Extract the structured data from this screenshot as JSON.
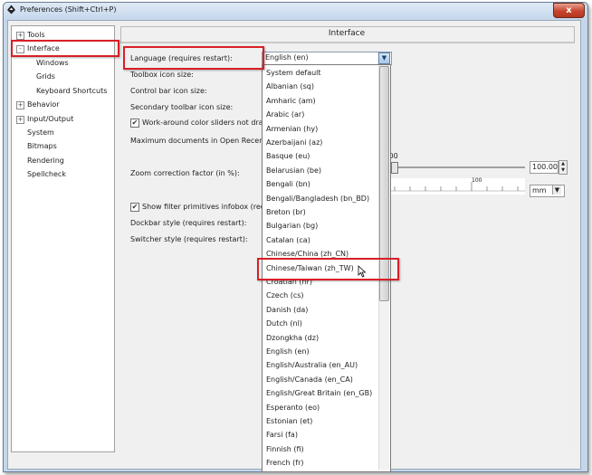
{
  "window": {
    "title": "Preferences (Shift+Ctrl+P)",
    "close_label": "x"
  },
  "sidebar": {
    "items": [
      {
        "label": "Tools",
        "expander": "+"
      },
      {
        "label": "Interface",
        "expander": "-"
      },
      {
        "label": "Windows"
      },
      {
        "label": "Grids"
      },
      {
        "label": "Keyboard Shortcuts"
      },
      {
        "label": "Behavior",
        "expander": "+"
      },
      {
        "label": "Input/Output",
        "expander": "+"
      },
      {
        "label": "System"
      },
      {
        "label": "Bitmaps"
      },
      {
        "label": "Rendering"
      },
      {
        "label": "Spellcheck"
      }
    ]
  },
  "panel": {
    "heading": "Interface",
    "language_label": "Language (requires restart):",
    "language_value": "English (en)",
    "toolbox_icon_label": "Toolbox icon size:",
    "control_bar_icon_label": "Control bar icon size:",
    "secondary_toolbar_label": "Secondary toolbar icon size:",
    "workaround_label": "Work-around color sliders not drawin",
    "workaround_checked": "✔",
    "max_docs_label": "Maximum documents in Open Recent:",
    "zoom_correction_label": "Zoom correction factor (in %):",
    "zoom_value_partial": ".00",
    "zoom_value": "100.00",
    "ruler_tick": "100",
    "unit_value": "mm",
    "filter_label": "Show filter primitives infobox (require",
    "filter_checked": "✔",
    "dockbar_label": "Dockbar style (requires restart):",
    "switcher_label": "Switcher style (requires restart):"
  },
  "language_options": [
    "System default",
    "Albanian (sq)",
    "Amharic (am)",
    "Arabic (ar)",
    "Armenian (hy)",
    "Azerbaijani (az)",
    "Basque (eu)",
    "Belarusian (be)",
    "Bengali (bn)",
    "Bengali/Bangladesh (bn_BD)",
    "Breton (br)",
    "Bulgarian (bg)",
    "Catalan (ca)",
    "Chinese/China (zh_CN)",
    "Chinese/Taiwan (zh_TW)",
    "Croatian (hr)",
    "Czech (cs)",
    "Danish (da)",
    "Dutch (nl)",
    "Dzongkha (dz)",
    "English (en)",
    "English/Australia (en_AU)",
    "English/Canada (en_CA)",
    "English/Great Britain (en_GB)",
    "Esperanto (eo)",
    "Estonian (et)",
    "Farsi (fa)",
    "Finnish (fi)",
    "French (fr)"
  ],
  "highlighted_option": "Chinese/Taiwan (zh_TW)",
  "icons": {
    "app": "inkscape-icon",
    "combo_arrow": "chevron-down-icon",
    "cursor": "mouse-pointer-icon"
  },
  "colors": {
    "highlight_box": "#d91f26",
    "titlebar": "#c6d8ec",
    "close_button": "#c7452e"
  }
}
